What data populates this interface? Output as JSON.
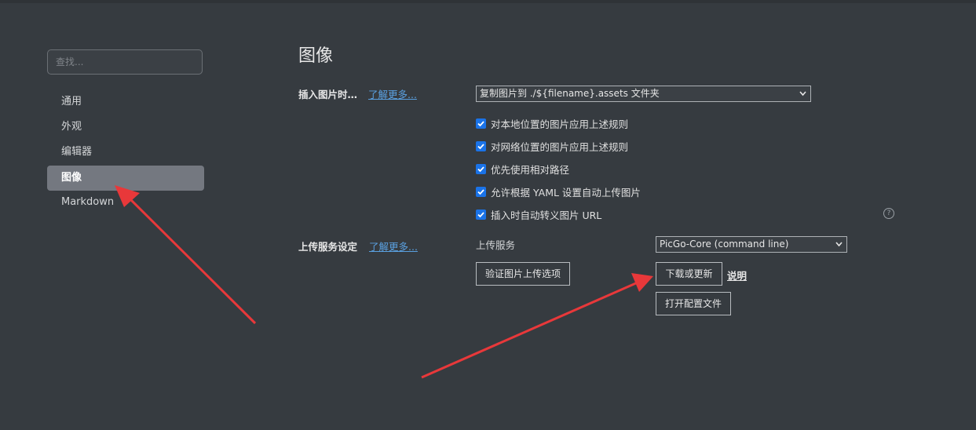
{
  "sidebar": {
    "search_placeholder": "查找...",
    "items": [
      {
        "label": "通用"
      },
      {
        "label": "外观"
      },
      {
        "label": "编辑器"
      },
      {
        "label": "图像",
        "active": true
      },
      {
        "label": "Markdown"
      }
    ]
  },
  "main": {
    "title": "图像",
    "insert_image": {
      "label": "插入图片时…",
      "learn_more": "了解更多...",
      "action_select": "复制图片到 ./${filename}.assets 文件夹",
      "checkboxes": [
        {
          "label": "对本地位置的图片应用上述规则",
          "checked": true
        },
        {
          "label": "对网络位置的图片应用上述规则",
          "checked": true
        },
        {
          "label": "优先使用相对路径",
          "checked": true
        },
        {
          "label": "允许根据 YAML 设置自动上传图片",
          "checked": true
        },
        {
          "label": "插入时自动转义图片 URL",
          "checked": true
        }
      ],
      "help_icon": "?"
    },
    "upload": {
      "label": "上传服务设定",
      "learn_more": "了解更多...",
      "service_label": "上传服务",
      "service_select": "PicGo-Core (command line)",
      "verify_button": "验证图片上传选项",
      "download_button": "下载或更新",
      "explain_link": "说明",
      "open_config_button": "打开配置文件"
    }
  },
  "colors": {
    "background": "#363b40",
    "active_nav": "#747880",
    "checkbox": "#1a73e8",
    "link": "#5aa0e0",
    "annotation_arrow": "#e8383a"
  }
}
